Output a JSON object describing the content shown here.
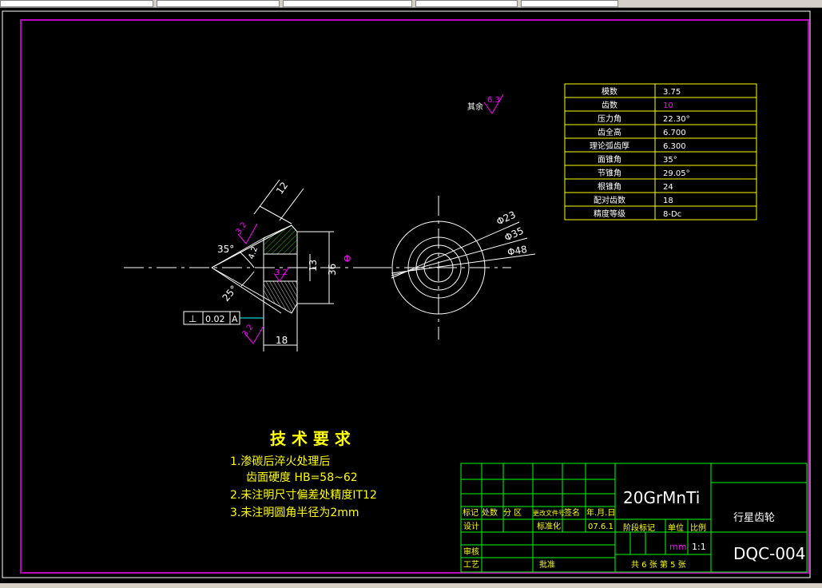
{
  "toolbar": {
    "cells": [
      "",
      "",
      "",
      "",
      ""
    ]
  },
  "status": {
    "text": ""
  },
  "drawing": {
    "surface_finish_other": "其余",
    "surface_roughness_main": "6.3",
    "roughness_small": "3.2",
    "dims": {
      "d12": "12",
      "a35": "35°",
      "a25": "25°",
      "d13": "13",
      "d36": "36",
      "d18": "18",
      "d_circle": "Φ",
      "phi23": "Φ23",
      "phi35": "Φ35",
      "phi48": "Φ48",
      "d42": "4.2"
    },
    "tolerance": {
      "symbol": "⊥",
      "value": "0.02",
      "datum": "A"
    }
  },
  "gear_table": [
    {
      "name": "模数",
      "value": "3.75"
    },
    {
      "name": "齿数",
      "value": "10"
    },
    {
      "name": "压力角",
      "value": "22.30°"
    },
    {
      "name": "齿全高",
      "value": "6.700"
    },
    {
      "name": "理论弧齿厚",
      "value": "6.300"
    },
    {
      "name": "面锥角",
      "value": "35°"
    },
    {
      "name": "节锥角",
      "value": "29.05°"
    },
    {
      "name": "根锥角",
      "value": "24"
    },
    {
      "name": "配对齿数",
      "value": "18"
    },
    {
      "name": "精度等级",
      "value": "8-Dc"
    }
  ],
  "tech_req": {
    "title": "技 术 要 求",
    "line1": "1.渗碳后淬火处理后",
    "line2": "齿面硬度  HB=58~62",
    "line3": "2.未注明尺寸偏差处精度IT12",
    "line4": "3.未注明圆角半径为2mm"
  },
  "title_block": {
    "material": "20GrMnTi",
    "part_name": "行星齿轮",
    "drawing_no": "DQC-004",
    "h_mark": "标记",
    "h_count": "处数",
    "h_zone": "分  区",
    "h_doc": "更改文件号",
    "h_sign": "签名",
    "h_date": "年.月.日",
    "design": "设计",
    "standard": "标准化",
    "date": "07.6.1",
    "stage": "阶段标记",
    "unit_label": "单位",
    "scale_label": "比例",
    "unit": "mm",
    "scale": "1:1",
    "review": "审核",
    "process": "工艺",
    "approve": "批准",
    "sheets": "共 6 张   第 5 张"
  },
  "colors": {
    "frame": "#c000c0",
    "line": "#ffffff",
    "table_border": "#ffff00",
    "tech_text": "#ffff00",
    "title_block": "#00ff00",
    "hatch": "#00c000",
    "dim_cyan": "#00ffff",
    "magenta": "#ff00ff"
  }
}
